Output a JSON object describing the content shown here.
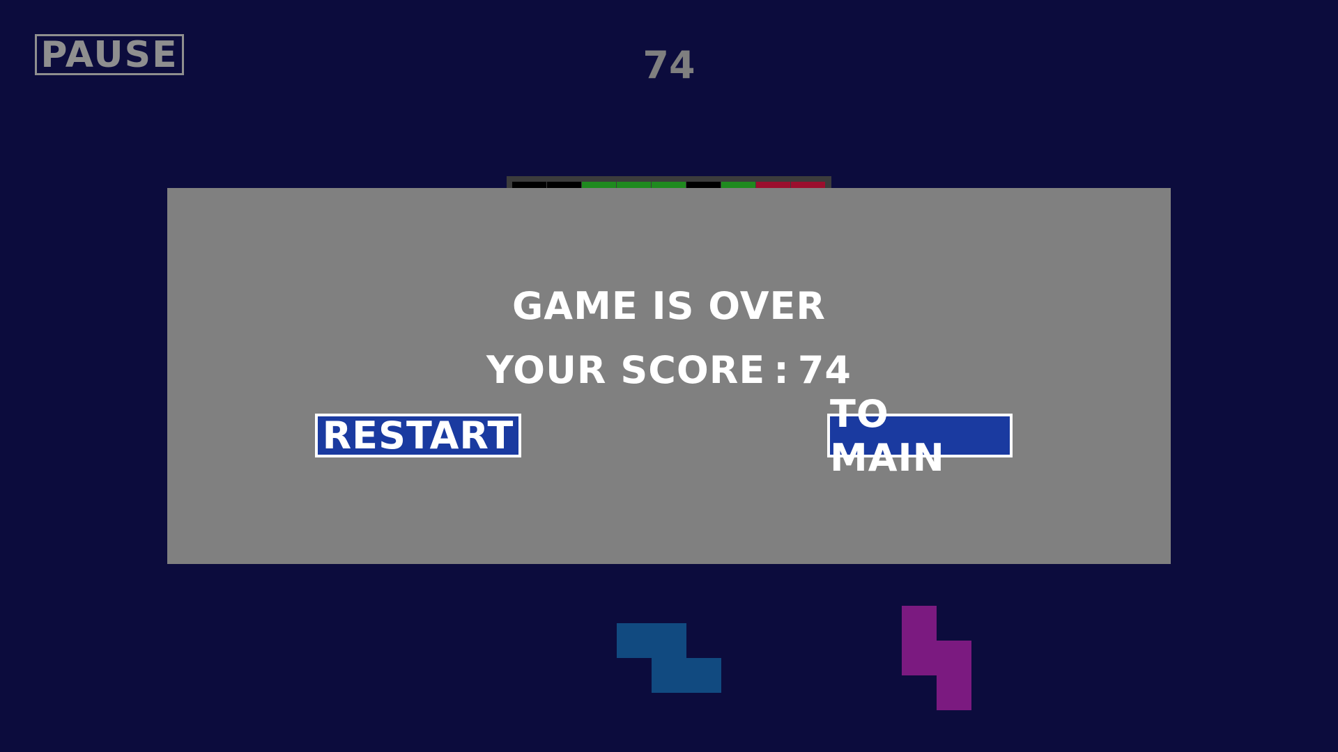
{
  "hud": {
    "pause_label": "PAUSE",
    "score": "74"
  },
  "board_row": [
    "#000000",
    "#000000",
    "#1f8a1f",
    "#1f8a1f",
    "#1f8a1f",
    "#000000",
    "#1f8a1f",
    "#9b0f2e",
    "#9b0f2e"
  ],
  "game_over": {
    "title": "GAME IS OVER",
    "score_label": "YOUR SCORE",
    "separator": ":",
    "score_value": "74",
    "restart_label": "RESTART",
    "to_main_label": "TO MAIN"
  },
  "next_pieces": [
    {
      "name": "Z",
      "color": "#114a80"
    },
    {
      "name": "S",
      "color": "#7b1a80"
    }
  ],
  "colors": {
    "background": "#0c0c3d",
    "overlay": "#808080",
    "button": "#1a3aa0",
    "hud_text": "#8f8f8f"
  }
}
